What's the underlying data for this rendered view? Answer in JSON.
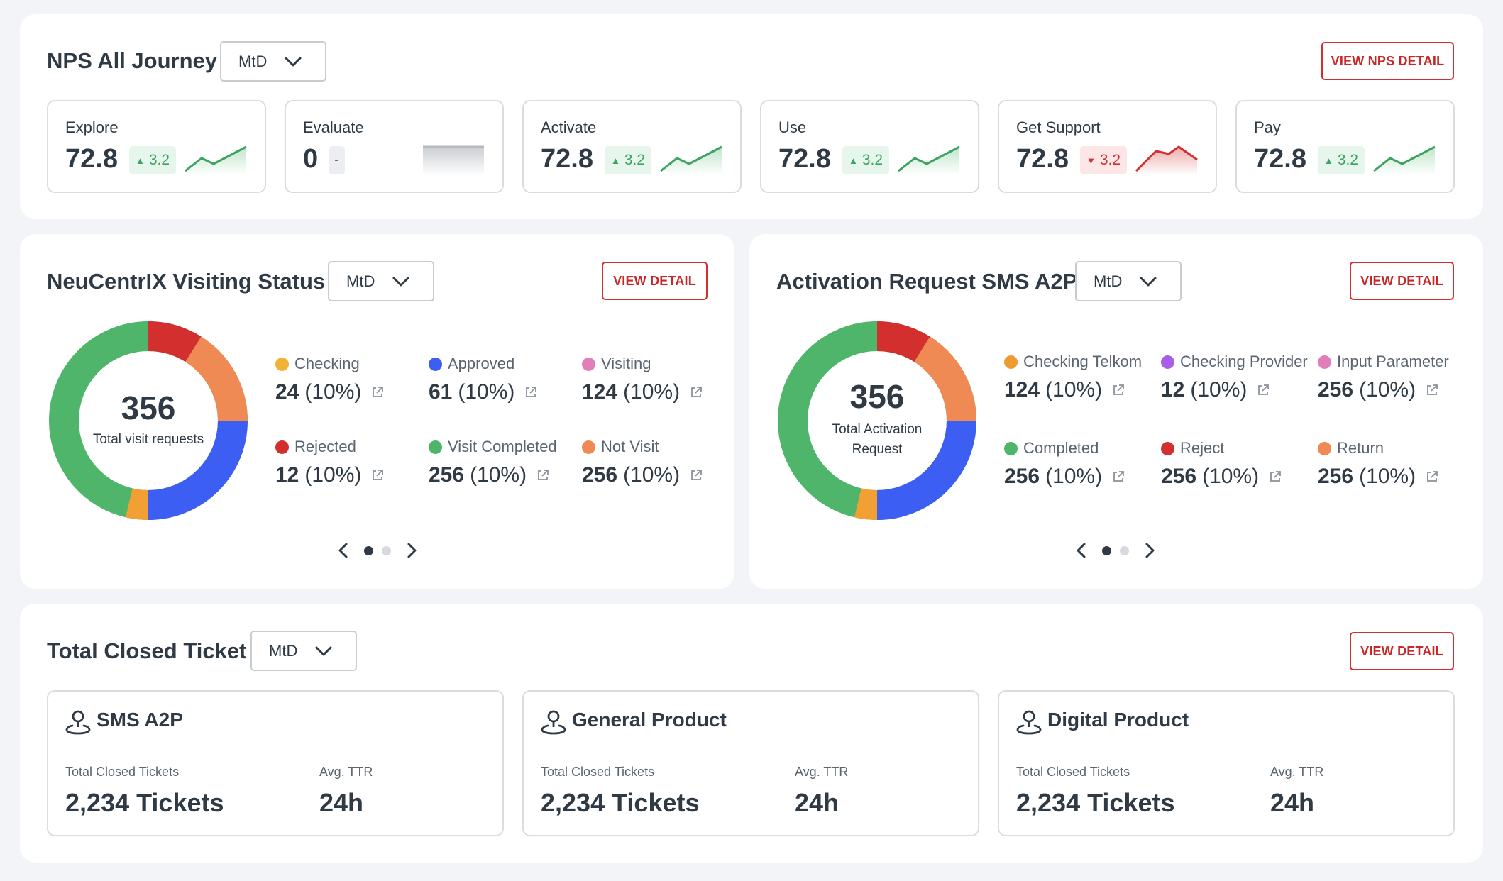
{
  "nps": {
    "title": "NPS All Journey",
    "period": "MtD",
    "view_button": "VIEW NPS DETAIL",
    "cards": [
      {
        "label": "Explore",
        "value": "72.8",
        "delta": "3.2",
        "trend": "up"
      },
      {
        "label": "Evaluate",
        "value": "0",
        "delta": "-",
        "trend": "neutral"
      },
      {
        "label": "Activate",
        "value": "72.8",
        "delta": "3.2",
        "trend": "up"
      },
      {
        "label": "Use",
        "value": "72.8",
        "delta": "3.2",
        "trend": "up"
      },
      {
        "label": "Get Support",
        "value": "72.8",
        "delta": "3.2",
        "trend": "down"
      },
      {
        "label": "Pay",
        "value": "72.8",
        "delta": "3.2",
        "trend": "up"
      }
    ]
  },
  "visiting": {
    "title": "NeuCentrIX Visiting Status",
    "period": "MtD",
    "view_button": "VIEW DETAIL",
    "total": "356",
    "total_label": "Total visit requests",
    "legend": [
      {
        "label": "Checking",
        "value": "24",
        "pct": "(10%)",
        "color": "#f2b233"
      },
      {
        "label": "Approved",
        "value": "61",
        "pct": "(10%)",
        "color": "#3c5ef2"
      },
      {
        "label": "Visiting",
        "value": "124",
        "pct": "(10%)",
        "color": "#e07fb8"
      },
      {
        "label": "Rejected",
        "value": "12",
        "pct": "(10%)",
        "color": "#d32f2f"
      },
      {
        "label": "Visit Completed",
        "value": "256",
        "pct": "(10%)",
        "color": "#4eb56b"
      },
      {
        "label": "Not Visit",
        "value": "256",
        "pct": "(10%)",
        "color": "#ef8a55"
      }
    ]
  },
  "activation": {
    "title": "Activation Request SMS A2P",
    "period": "MtD",
    "view_button": "VIEW DETAIL",
    "total": "356",
    "total_label_1": "Total Activation",
    "total_label_2": "Request",
    "legend": [
      {
        "label": "Checking Telkom",
        "value": "124",
        "pct": "(10%)",
        "color": "#ef9a33"
      },
      {
        "label": "Checking Provider",
        "value": "12",
        "pct": "(10%)",
        "color": "#a85ee8"
      },
      {
        "label": "Input Parameter",
        "value": "256",
        "pct": "(10%)",
        "color": "#e07fb8"
      },
      {
        "label": "Completed",
        "value": "256",
        "pct": "(10%)",
        "color": "#4eb56b"
      },
      {
        "label": "Reject",
        "value": "256",
        "pct": "(10%)",
        "color": "#d32f2f"
      },
      {
        "label": "Return",
        "value": "256",
        "pct": "(10%)",
        "color": "#ef8a55"
      }
    ]
  },
  "tickets": {
    "title": "Total Closed Ticket",
    "period": "MtD",
    "view_button": "VIEW DETAIL",
    "cards": [
      {
        "title": "SMS A2P",
        "closed_label": "Total Closed Tickets",
        "closed_value": "2,234 Tickets",
        "ttr_label": "Avg. TTR",
        "ttr_value": "24h"
      },
      {
        "title": "General Product",
        "closed_label": "Total Closed Tickets",
        "closed_value": "2,234 Tickets",
        "ttr_label": "Avg. TTR",
        "ttr_value": "24h"
      },
      {
        "title": "Digital Product",
        "closed_label": "Total Closed Tickets",
        "closed_value": "2,234 Tickets",
        "ttr_label": "Avg. TTR",
        "ttr_value": "24h"
      }
    ]
  },
  "icons": {
    "dropdown": "chevron-down-icon",
    "external": "external-link-icon",
    "prev": "chevron-left-icon",
    "next": "chevron-right-icon",
    "ticket": "location-user-icon"
  },
  "colors": {
    "accent_red": "#d32f2f",
    "positive": "#3aa35f",
    "negative": "#d32f2f",
    "donut_green": "#4eb56b",
    "donut_red": "#d32f2f",
    "donut_orange": "#ef8a55",
    "donut_blue": "#3c5ef2",
    "donut_yellow": "#f2a033"
  }
}
